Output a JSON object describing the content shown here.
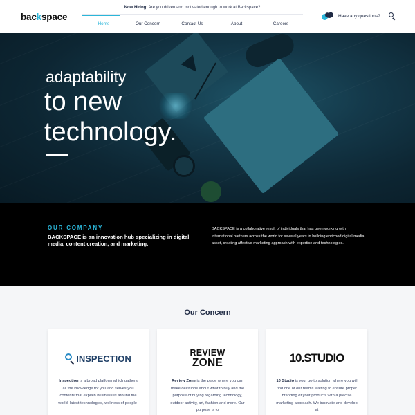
{
  "header": {
    "logo_left": "bac",
    "logo_accent": "k",
    "logo_right": "space",
    "hiring_label": "Now Hiring:",
    "hiring_text": " Are you driven and motivated enough to work at Backspace?",
    "questions_label": "Have any questions?"
  },
  "nav": {
    "items": [
      {
        "label": "Home",
        "active": true
      },
      {
        "label": "Our Concern"
      },
      {
        "label": "Contact Us"
      },
      {
        "label": "About"
      },
      {
        "label": "Careers"
      }
    ]
  },
  "hero": {
    "line1": "adaptability",
    "line2": "to new",
    "line3": "technology."
  },
  "company": {
    "eyebrow": "OUR COMPANY",
    "headline": "BACKSPACE is an innovation hub specializing in digital media, content creation, and marketing.",
    "description": "BACKSPACE is a collaborative result of individuals that has been working with international partners across the world for several years in building enriched digital media asset, creating affective marketing approach with expertise and technologies."
  },
  "concern": {
    "title": "Our Concern",
    "cards": [
      {
        "logo_text": "INSPECTION",
        "name": "Inspection",
        "text": " is a broad platform which gathers all the knowledge for you and serves you contents that explain businesses around the world, latest technologies, wellness of people-"
      },
      {
        "logo_line1": "REVIEW",
        "logo_line2": "ZONE",
        "name": "Review Zone",
        "text": " is the place where you can make decisions about what to buy and the purpose of buying regarding technology, outdoor activity, art, fashion and more. Our purpose is to"
      },
      {
        "logo_text": "10.STUDIO",
        "name": "10 Studio",
        "text": " is your go-to solution where you will find one of our teams waiting to ensure proper branding of your products with a precise marketing approach. We innovate and develop at"
      }
    ]
  },
  "colors": {
    "accent": "#2bb6d9",
    "navy": "#1f2a44",
    "band": "#000000"
  },
  "icons": [
    "chat-bubbles-icon",
    "search-icon",
    "magnifier-icon"
  ]
}
